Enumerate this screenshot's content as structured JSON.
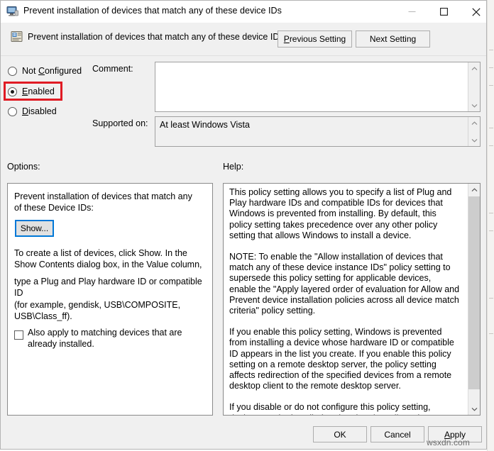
{
  "window": {
    "title": "Prevent installation of devices that match any of these device IDs",
    "title_icon": "computer-monitor-icon",
    "controls": {
      "minimize": "minimize-icon",
      "maximize": "maximize-icon",
      "close": "close-icon"
    }
  },
  "header": {
    "icon": "policy-setting-icon",
    "setting_name": "Prevent installation of devices that match any of these device IDs",
    "previous_setting": "Previous Setting",
    "previous_setting_accel": "P",
    "next_setting": "Next Setting"
  },
  "state": {
    "options": [
      {
        "label": "Not Configured",
        "accel": "C",
        "selected": false
      },
      {
        "label": "Enabled",
        "accel": "E",
        "selected": true
      },
      {
        "label": "Disabled",
        "accel": "D",
        "selected": false
      }
    ],
    "highlight_color": "#e01b24",
    "highlighted_option": "Enabled"
  },
  "comment": {
    "label": "Comment:",
    "value": "",
    "placeholder": ""
  },
  "supported_on": {
    "label": "Supported on:",
    "value": "At least Windows Vista"
  },
  "options_panel": {
    "section_label": "Options:",
    "heading": "Prevent installation of devices that match any of these Device IDs:",
    "show_button": "Show...",
    "show_button_focus_color": "#0078d7",
    "instruction_1": "To create a list of devices, click Show. In the Show Contents dialog box, in the Value column,",
    "instruction_2": "type a Plug and Play hardware ID or compatible ID",
    "instruction_3": "(for example, gendisk, USB\\COMPOSITE, USB\\Class_ff).",
    "checkbox_label": "Also apply to matching devices that are already installed.",
    "checkbox_checked": false
  },
  "help_panel": {
    "section_label": "Help:",
    "paragraphs": [
      "This policy setting allows you to specify a list of Plug and Play hardware IDs and compatible IDs for devices that Windows is prevented from installing. By default, this policy setting takes precedence over any other policy setting that allows Windows to install a device.",
      "NOTE: To enable the \"Allow installation of devices that match any of these device instance IDs\" policy setting to supersede this policy setting for applicable devices, enable the \"Apply layered order of evaluation for Allow and Prevent device installation policies across all device match criteria\" policy setting.",
      "If you enable this policy setting, Windows is prevented from installing a device whose hardware ID or compatible ID appears in the list you create. If you enable this policy setting on a remote desktop server, the policy setting affects redirection of the specified devices from a remote desktop client to the remote desktop server.",
      "If you disable or do not configure this policy setting, devices can be installed and updated as allowed or prevented by other policy"
    ]
  },
  "footer": {
    "ok": "OK",
    "cancel": "Cancel",
    "apply": "Apply",
    "apply_accel": "A"
  },
  "watermark": "wsxdn.com"
}
